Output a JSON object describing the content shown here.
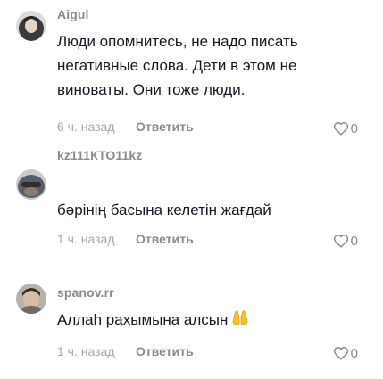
{
  "comments": [
    {
      "username": "Aigul",
      "text": "Люди опомнитесь, не надо писать негативные слова. Дети в этом не виноваты. Они тоже люди.",
      "time": "6 ч. назад",
      "reply_label": "Ответить",
      "likes": "0"
    },
    {
      "username": "kz111КТО11kz",
      "text": "бәрінің басына келетін жағдай",
      "time": "1 ч. назад",
      "reply_label": "Ответить",
      "likes": "0"
    },
    {
      "username": "spanov.rr",
      "text": "Аллаһ рахымына алсын",
      "text_emoji": "folded-hands-emoji",
      "time": "1 ч. назад",
      "reply_label": "Ответить",
      "likes": "0"
    }
  ],
  "icons": {
    "like": "heart-outline-icon"
  },
  "colors": {
    "username": "#8a8b91",
    "text": "#161823",
    "timestamp": "#a7a8ad",
    "reply": "#8a8b91"
  }
}
